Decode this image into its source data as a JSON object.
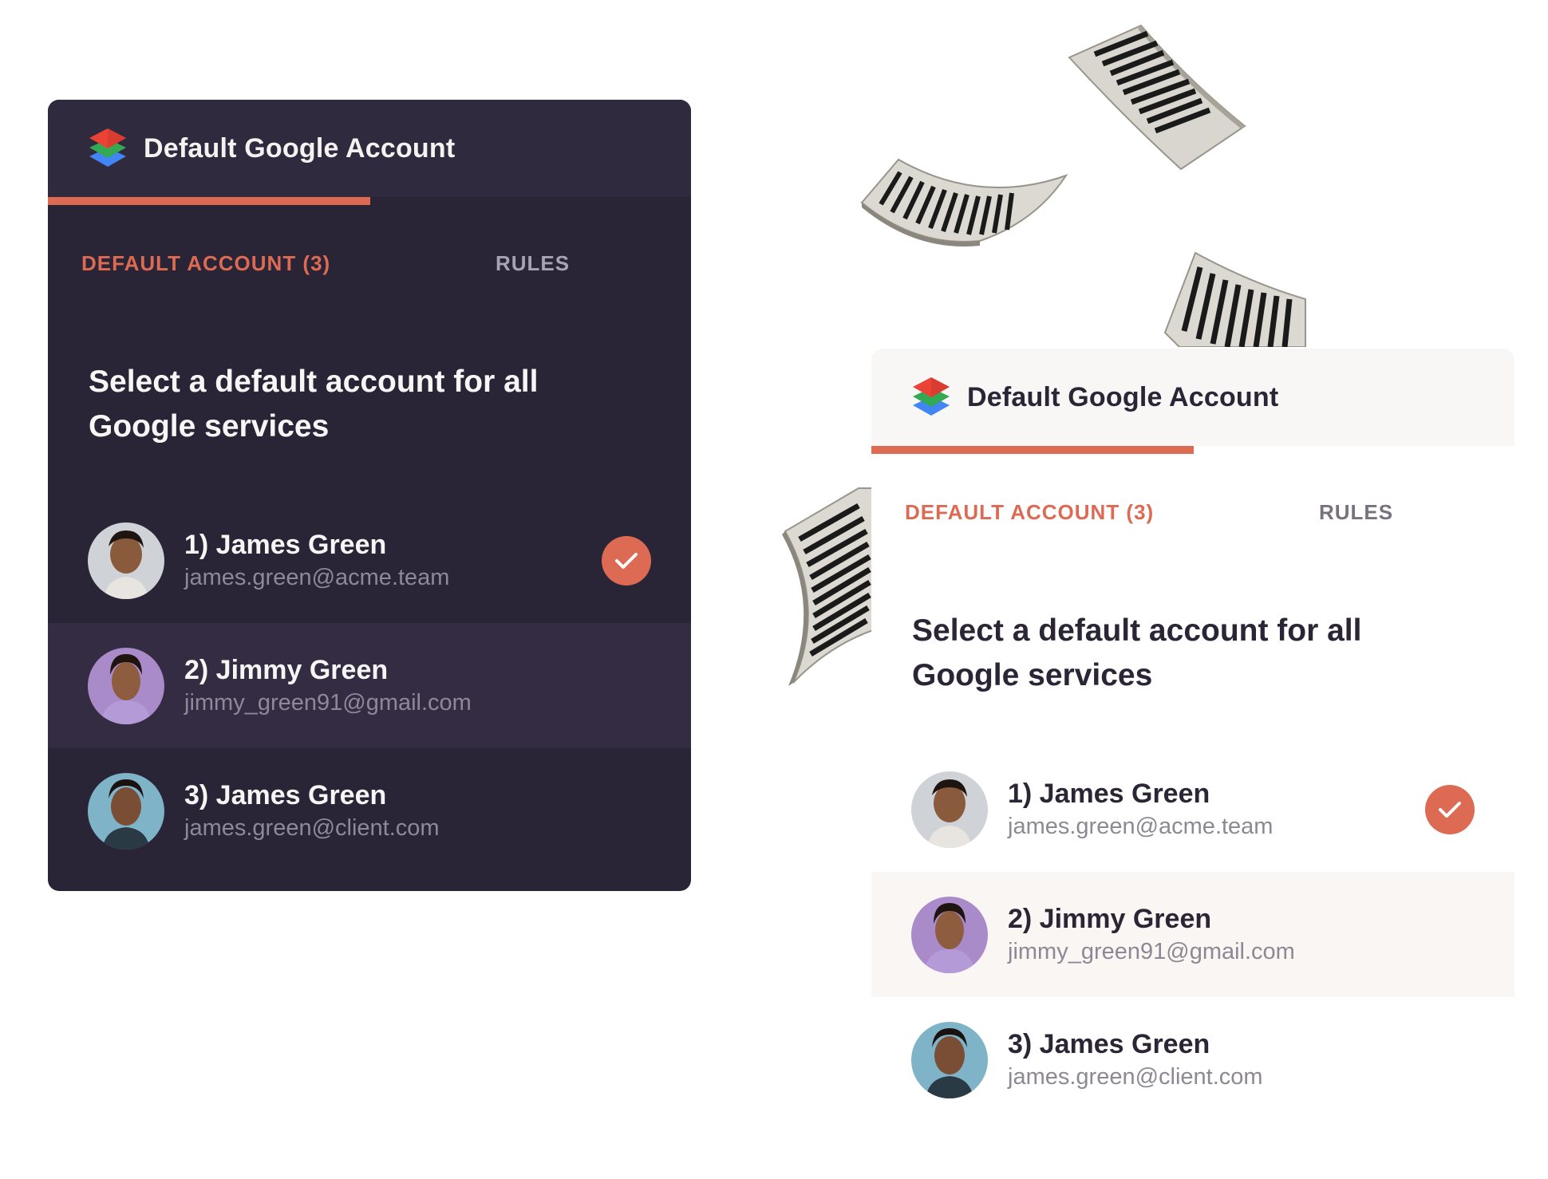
{
  "panels": [
    {
      "theme": "dark",
      "title": "Default Google Account",
      "logo_icon": "layered-stack-icon",
      "tabs": [
        {
          "label": "DEFAULT ACCOUNT (3)",
          "active": true
        },
        {
          "label": "RULES",
          "active": false
        }
      ],
      "heading": "Select a default account for all Google services",
      "accounts": [
        {
          "name": "1) James Green",
          "email": "james.green@acme.team",
          "selected": true
        },
        {
          "name": "2) Jimmy Green",
          "email": "jimmy_green91@gmail.com",
          "selected": false
        },
        {
          "name": "3) James Green",
          "email": "james.green@client.com",
          "selected": false
        }
      ]
    },
    {
      "theme": "light",
      "title": "Default Google Account",
      "logo_icon": "layered-stack-icon",
      "tabs": [
        {
          "label": "DEFAULT ACCOUNT (3)",
          "active": true
        },
        {
          "label": "RULES",
          "active": false
        }
      ],
      "heading": "Select a default account for all Google services",
      "accounts": [
        {
          "name": "1) James Green",
          "email": "james.green@acme.team",
          "selected": true
        },
        {
          "name": "2) Jimmy Green",
          "email": "jimmy_green91@gmail.com",
          "selected": false
        },
        {
          "name": "3) James Green",
          "email": "james.green@client.com",
          "selected": false
        }
      ]
    }
  ],
  "colors": {
    "accent": "#dd6a52",
    "dark_bg": "#2a2437",
    "light_bg": "#ffffff"
  },
  "icons": {
    "selected": "check-icon",
    "decoration": "flying-document-icon"
  }
}
